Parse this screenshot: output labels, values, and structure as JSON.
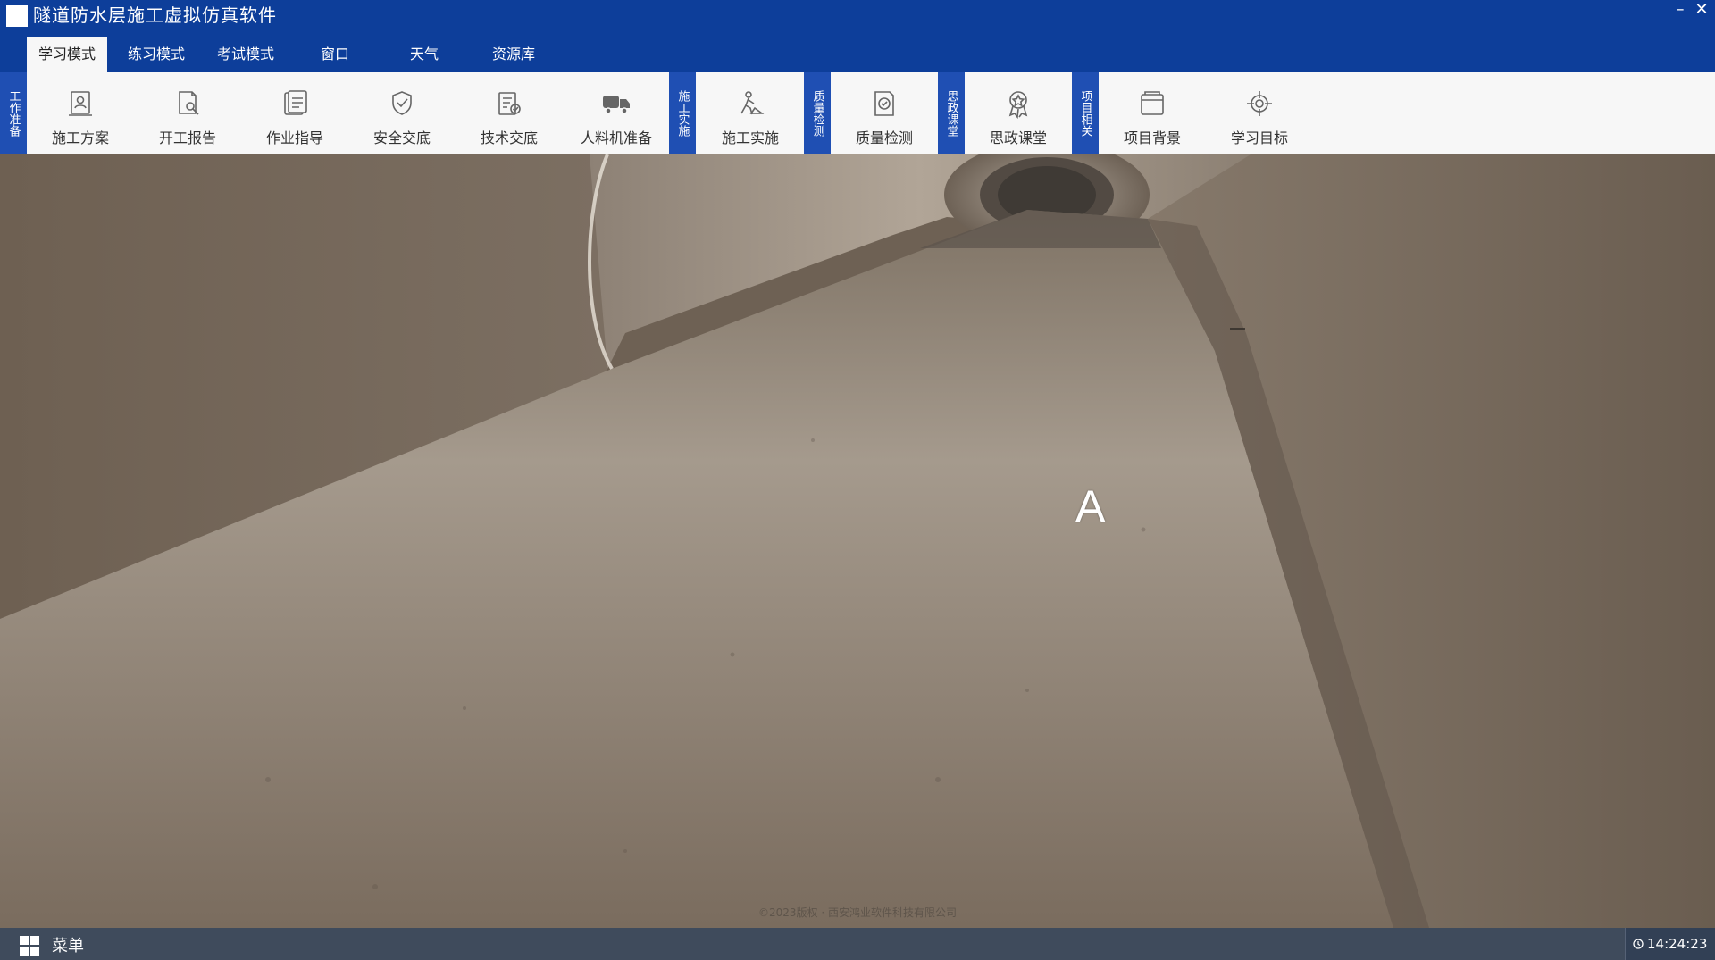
{
  "window": {
    "title": "隧道防水层施工虚拟仿真软件",
    "minimize_glyph": "–",
    "close_glyph": "✕"
  },
  "menu": {
    "tabs": [
      {
        "label": "学习模式",
        "active": true
      },
      {
        "label": "练习模式",
        "active": false
      },
      {
        "label": "考试模式",
        "active": false
      },
      {
        "label": "窗口",
        "active": false
      },
      {
        "label": "天气",
        "active": false
      },
      {
        "label": "资源库",
        "active": false
      }
    ]
  },
  "ribbon": {
    "groups": [
      {
        "label": "工作准备",
        "buttons": [
          {
            "label": "施工方案",
            "icon": "document-user-icon"
          },
          {
            "label": "开工报告",
            "icon": "report-wrench-icon"
          },
          {
            "label": "作业指导",
            "icon": "guide-document-icon"
          },
          {
            "label": "安全交底",
            "icon": "safety-shield-icon"
          },
          {
            "label": "技术交底",
            "icon": "tech-checklist-icon"
          },
          {
            "label": "人料机准备",
            "icon": "truck-icon"
          }
        ]
      },
      {
        "label": "施工实施",
        "buttons": [
          {
            "label": "施工实施",
            "icon": "worker-icon"
          }
        ]
      },
      {
        "label": "质量检测",
        "buttons": [
          {
            "label": "质量检测",
            "icon": "quality-check-icon"
          }
        ]
      },
      {
        "label": "思政课堂",
        "buttons": [
          {
            "label": "思政课堂",
            "icon": "award-badge-icon"
          }
        ]
      },
      {
        "label": "项目相关",
        "buttons": [
          {
            "label": "项目背景",
            "icon": "project-folder-icon"
          },
          {
            "label": "学习目标",
            "icon": "target-icon"
          }
        ]
      }
    ]
  },
  "viewport": {
    "marker_label": "A",
    "watermark": "©2023版权 · 西安鸿业软件科技有限公司"
  },
  "taskbar": {
    "menu_label": "菜单",
    "clock": "14:24:23"
  },
  "colors": {
    "titlebar": "#0d3e9a",
    "group_label": "#1f4fb3",
    "ribbon_bg": "#f7f7f7",
    "taskbar": "#3f4b5c"
  }
}
